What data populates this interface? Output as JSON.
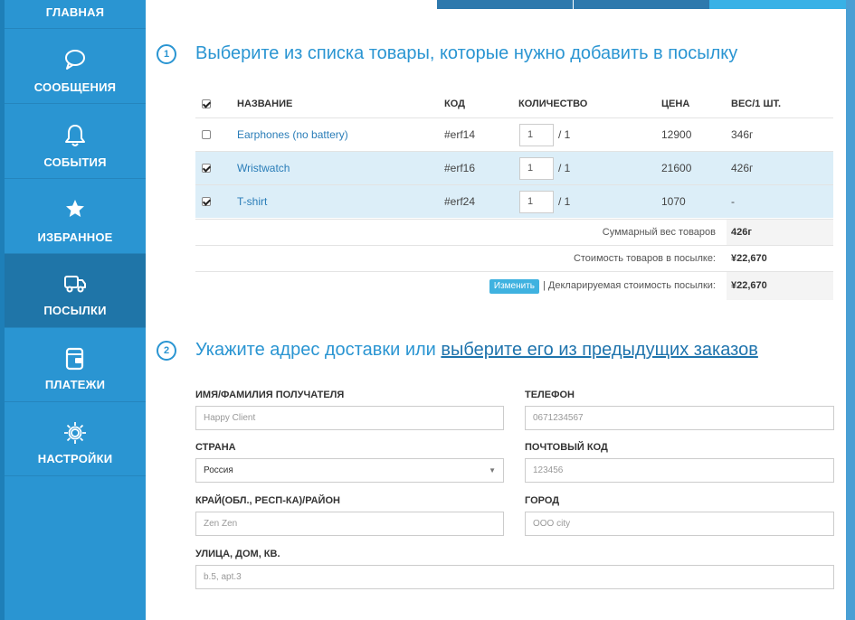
{
  "sidebar": {
    "items": [
      {
        "label": "ГЛАВНАЯ",
        "icon": "home-icon"
      },
      {
        "label": "СООБЩЕНИЯ",
        "icon": "chat-bubble-icon"
      },
      {
        "label": "СОБЫТИЯ",
        "icon": "bell-icon"
      },
      {
        "label": "ИЗБРАННОЕ",
        "icon": "star-icon"
      },
      {
        "label": "ПОСЫЛКИ",
        "icon": "truck-icon",
        "active": true
      },
      {
        "label": "ПЛАТЕЖИ",
        "icon": "wallet-icon"
      },
      {
        "label": "НАСТРОЙКИ",
        "icon": "gear-icon"
      }
    ]
  },
  "step1": {
    "number": "1",
    "title": "Выберите из списка товары, которые нужно добавить в посылку"
  },
  "table": {
    "headers": {
      "name": "НАЗВАНИЕ",
      "code": "КОД",
      "qty": "КОЛИЧЕСТВО",
      "price": "ЦЕНА",
      "weight": "ВЕС/1 ШТ."
    },
    "rows": [
      {
        "checked": false,
        "name": "Earphones (no battery)",
        "code": "#erf14",
        "qty": "1",
        "qty_max": "/ 1",
        "price": "12900",
        "weight": "346г"
      },
      {
        "checked": true,
        "name": "Wristwatch",
        "code": "#erf16",
        "qty": "1",
        "qty_max": "/ 1",
        "price": "21600",
        "weight": "426г"
      },
      {
        "checked": true,
        "name": "T-shirt",
        "code": "#erf24",
        "qty": "1",
        "qty_max": "/ 1",
        "price": "1070",
        "weight": "-"
      }
    ],
    "summary": {
      "total_weight_label": "Суммарный вес товаров",
      "total_weight": "426г",
      "cost_label": "Стоимость товаров в посылке:",
      "cost": "¥22,670",
      "change_button": "Изменить",
      "declared_label": "| Декларируемая стоимость посылки:",
      "declared": "¥22,670"
    }
  },
  "step2": {
    "number": "2",
    "title": "Укажите адрес доставки или ",
    "title_link": "выберите его из предыдущих заказов"
  },
  "form": {
    "recipient_label": "ИМЯ/ФАМИЛИЯ ПОЛУЧАТЕЛЯ",
    "recipient_placeholder": "Happy Client",
    "phone_label": "ТЕЛЕФОН",
    "phone_placeholder": "0671234567",
    "country_label": "СТРАНА",
    "country_value": "Россия",
    "zip_label": "ПОЧТОВЫЙ КОД",
    "zip_placeholder": "123456",
    "region_label": "КРАЙ(ОБЛ., РЕСП-КА)/РАЙОН",
    "region_placeholder": "Zen Zen",
    "city_label": "ГОРОД",
    "city_placeholder": "OOO city",
    "street_label": "УЛИЦА, ДОМ, КВ.",
    "street_placeholder": "b.5, apt.3"
  },
  "colors": {
    "accent": "#2a95d2",
    "active_nav": "#1f75a8",
    "row_selected": "#dceef8"
  }
}
